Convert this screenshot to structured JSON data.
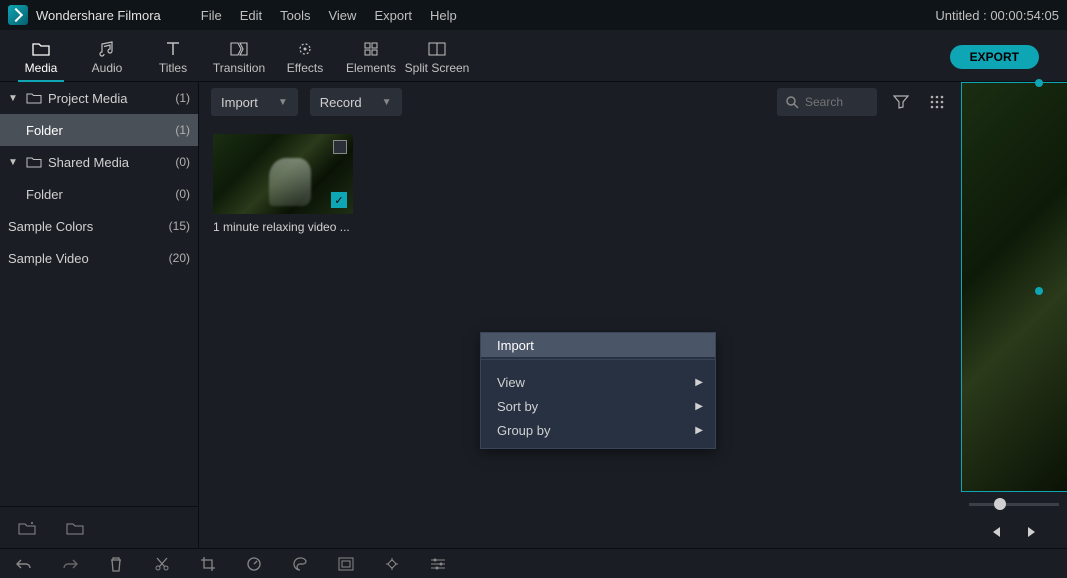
{
  "app": {
    "title": "Wondershare Filmora"
  },
  "menu": [
    "File",
    "Edit",
    "Tools",
    "View",
    "Export",
    "Help"
  ],
  "project": {
    "title": "Untitled :",
    "timecode": "00:00:54:05"
  },
  "tabs": [
    {
      "label": "Media",
      "active": true
    },
    {
      "label": "Audio"
    },
    {
      "label": "Titles"
    },
    {
      "label": "Transition"
    },
    {
      "label": "Effects"
    },
    {
      "label": "Elements"
    },
    {
      "label": "Split Screen"
    }
  ],
  "export_label": "EXPORT",
  "sidebar": {
    "items": [
      {
        "label": "Project Media",
        "count": "(1)",
        "expandable": true,
        "folder": true
      },
      {
        "label": "Folder",
        "count": "(1)",
        "indent": true,
        "selected": true
      },
      {
        "label": "Shared Media",
        "count": "(0)",
        "expandable": true,
        "folder": true
      },
      {
        "label": "Folder",
        "count": "(0)",
        "indent": true
      },
      {
        "label": "Sample Colors",
        "count": "(15)"
      },
      {
        "label": "Sample Video",
        "count": "(20)"
      }
    ]
  },
  "mediabar": {
    "import": "Import",
    "record": "Record",
    "search_placeholder": "Search"
  },
  "thumb": {
    "label": "1 minute relaxing video ..."
  },
  "ctx": {
    "items": [
      "Import",
      "View",
      "Sort by",
      "Group by"
    ]
  }
}
